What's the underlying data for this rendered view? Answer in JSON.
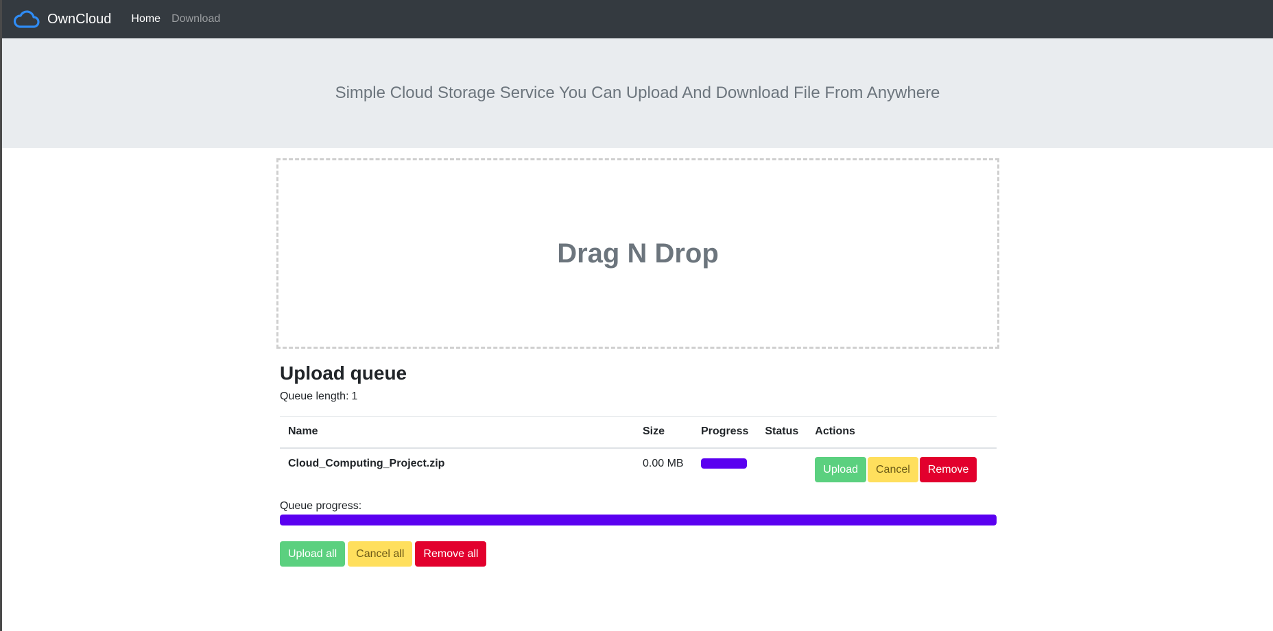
{
  "navbar": {
    "brand": "OwnCloud",
    "links": [
      "Home",
      "Download"
    ],
    "logo_icon": "cloud-icon",
    "brand_color": "#2f8cf5"
  },
  "hero": {
    "text": "Simple Cloud Storage Service You Can Upload And Download File From Anywhere"
  },
  "dropzone": {
    "text": "Drag N Drop"
  },
  "queue": {
    "title": "Upload queue",
    "length_label": "Queue length:",
    "length_value": "1",
    "columns": [
      "Name",
      "Size",
      "Progress",
      "Status",
      "Actions"
    ],
    "rows": [
      {
        "name": "Cloud_Computing_Project.zip",
        "size": "0.00 MB",
        "progress": 1.0,
        "status": "",
        "actions": [
          "Upload",
          "Cancel",
          "Remove"
        ]
      }
    ],
    "progress_label": "Queue progress:",
    "progress": 1.0,
    "bottom_actions": [
      "Upload all",
      "Cancel all",
      "Remove all"
    ]
  },
  "colors": {
    "navbar_bg": "#343a40",
    "hero_bg": "#e9ecef",
    "progress": "#5a00f0",
    "success": "#5bd07f",
    "warning": "#ffdf5d",
    "danger": "#e2002d"
  }
}
